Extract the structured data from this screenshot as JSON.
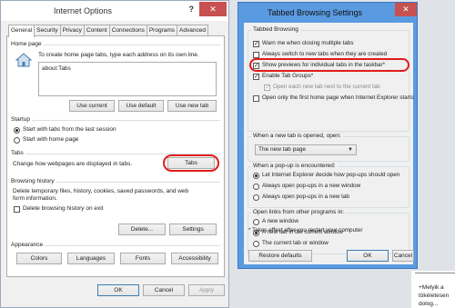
{
  "io": {
    "title": "Internet Options",
    "help": "?",
    "close": "✕",
    "tabs": [
      "General",
      "Security",
      "Privacy",
      "Content",
      "Connections",
      "Programs",
      "Advanced"
    ],
    "home": {
      "label": "Home page",
      "desc": "To create home page tabs, type each address on its own line.",
      "url": "about:Tabs",
      "use_current": "Use current",
      "use_default": "Use default",
      "use_new_tab": "Use new tab"
    },
    "startup": {
      "label": "Startup",
      "opt1": "Start with tabs from the last session",
      "opt2": "Start with home page"
    },
    "tabs_group": {
      "label": "Tabs",
      "desc": "Change how webpages are displayed in tabs.",
      "button": "Tabs"
    },
    "history": {
      "label": "Browsing history",
      "desc1": "Delete temporary files, history, cookies, saved passwords, and web",
      "desc2": "form information.",
      "on_exit": "Delete browsing history on exit",
      "delete": "Delete...",
      "settings": "Settings"
    },
    "appearance": {
      "label": "Appearance",
      "colors": "Colors",
      "languages": "Languages",
      "fonts": "Fonts",
      "accessibility": "Accessibility"
    },
    "footer": {
      "ok": "OK",
      "cancel": "Cancel",
      "apply": "Apply"
    }
  },
  "tb": {
    "title": "Tabbed Browsing Settings",
    "close": "✕",
    "section1": "Tabbed Browsing",
    "c1": "Warn me when closing multiple tabs",
    "c2": "Always switch to new tabs when they are created",
    "c3": "Show previews for individual tabs in the taskbar*",
    "c4": "Enable Tab Groups*",
    "c5": "Open each new tab next to the current tab",
    "c6": "Open only the first home page when Internet Explorer starts",
    "newtab_label": "When a new tab is opened, open:",
    "newtab_value": "The new tab page",
    "popup_label": "When a pop-up is encountered:",
    "p1": "Let Internet Explorer decide how pop-ups should open",
    "p2": "Always open pop-ups in a new window",
    "p3": "Always open pop-ups in a new tab",
    "links_label": "Open links from other programs in:",
    "l1": "A new window",
    "l2": "A new tab in the current window",
    "l3": "The current tab or window",
    "note": "* Takes effect after you restart your computer",
    "restore": "Restore defaults",
    "ok": "OK",
    "cancel": "Cancel"
  },
  "bg": {
    "line1": "+Melyik a",
    "line2": "tökéletesen",
    "line3": "dolog..."
  },
  "colors": {
    "accent_blue": "#5a9ae0",
    "close_red": "#c75050",
    "highlight_red": "#e21b1b"
  }
}
